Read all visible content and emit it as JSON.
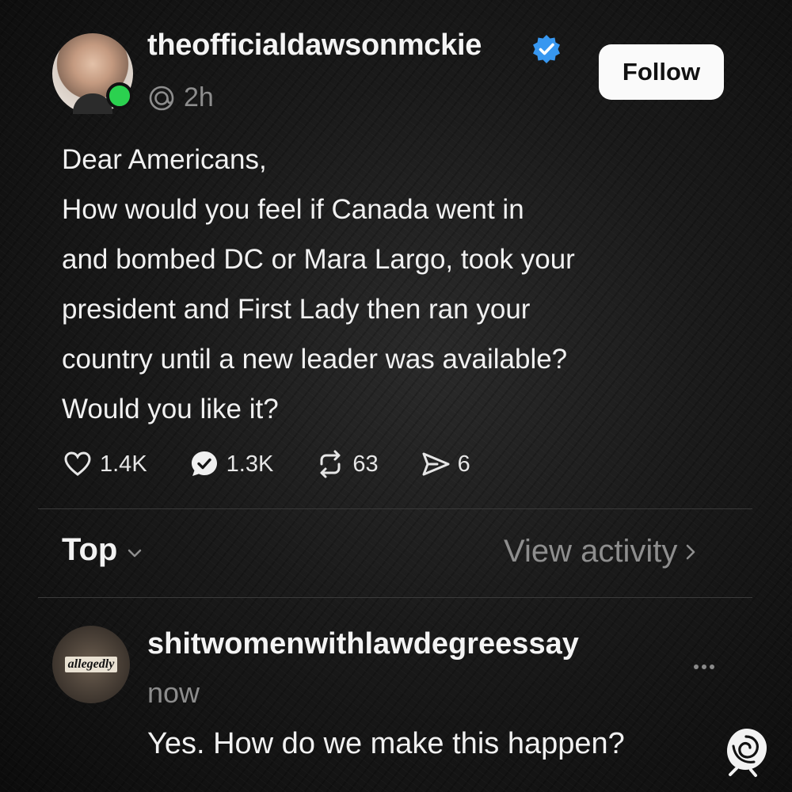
{
  "post": {
    "username": "theofficialdawsonmckie",
    "time": "2h",
    "follow_label": "Follow",
    "lines": [
      "Dear Americans,",
      "How would you feel if Canada went in",
      "and bombed DC or Mara Largo, took your",
      "president and First Lady then ran your",
      "country until a new leader was available?",
      "Would you like it?"
    ],
    "likes": "1.4K",
    "replies": "1.3K",
    "reposts": "63",
    "shares": "6"
  },
  "sort": {
    "label": "Top",
    "view_activity": "View activity"
  },
  "reply": {
    "avatar_text": "allegedly",
    "username": "shitwomenwithlawdegreessay",
    "time": "now",
    "text": "Yes. How do we make this happen?"
  },
  "colors": {
    "verified": "#3797f0",
    "online": "#2bd14f",
    "background": "#1a1a1a"
  }
}
